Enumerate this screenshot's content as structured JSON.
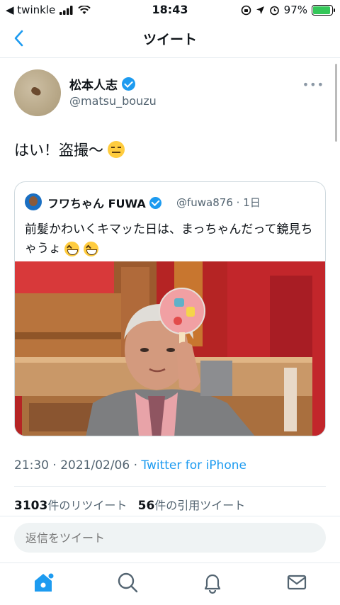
{
  "status_bar": {
    "carrier": "◀ twinkle",
    "time": "18:43",
    "battery_pct": "97%",
    "battery_level": 0.97
  },
  "header": {
    "title": "ツイート"
  },
  "author": {
    "name": "松本人志",
    "handle": "@matsu_bouzu"
  },
  "tweet": {
    "text": "はい！盗撮〜"
  },
  "quote": {
    "name": "フワちゃん FUWA",
    "handle": "@fuwa876",
    "time": "1日",
    "separator": "·",
    "text": "前髪かわいくキマッた日は、まっちゃんだって鏡見ちゃうょ"
  },
  "meta": {
    "time": "21:30 · 2021/02/06 · ",
    "source": "Twitter for iPhone"
  },
  "stats": {
    "retweet_count": "3103",
    "retweet_label": "件のリツイート",
    "quote_count": "56",
    "quote_label": "件の引用ツイート"
  },
  "reply": {
    "placeholder": "返信をツイート"
  },
  "tabs": [
    "home-icon",
    "search-icon",
    "notifications-icon",
    "messages-icon"
  ],
  "colors": {
    "accent": "#1d9bf0",
    "text": "#0f1419",
    "muted": "#536471"
  }
}
